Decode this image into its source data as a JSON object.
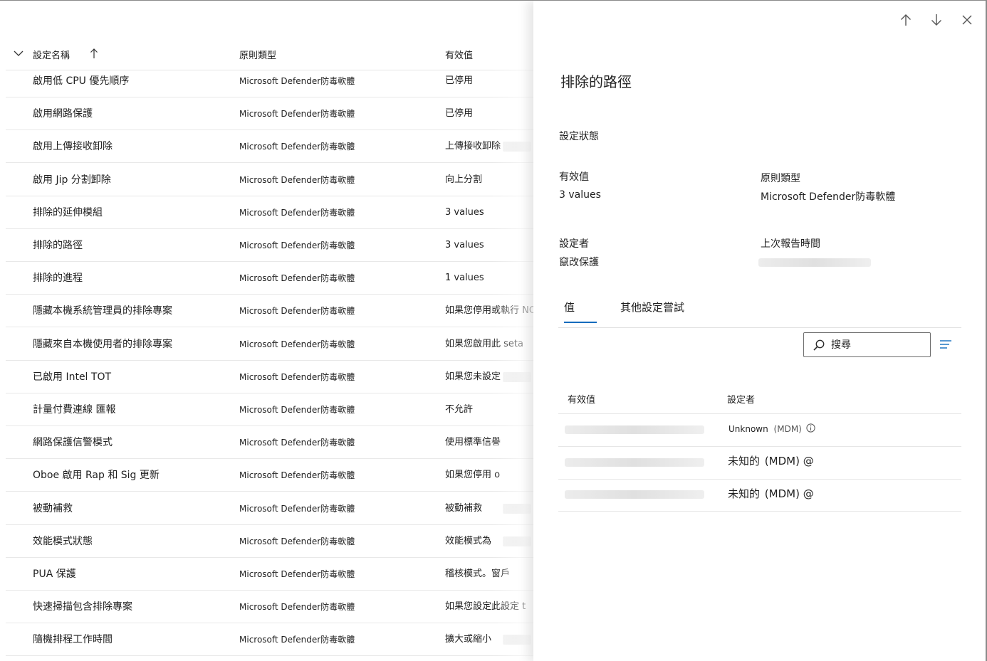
{
  "table": {
    "columns": [
      "設定名稱",
      "原則類型",
      "有效值"
    ],
    "rows": [
      {
        "name": "啟用低 CPU 優先順序",
        "type": "Microsoft Defender防毒軟體",
        "value": "已停用"
      },
      {
        "name": "啟用網路保護",
        "type": "Microsoft Defender防毒軟體",
        "value": "已停用"
      },
      {
        "name": "啟用上傳接收卸除",
        "type": "Microsoft Defender防毒軟體",
        "value": "上傳接收卸除"
      },
      {
        "name": "啟用 Jip 分割卸除",
        "type": "Microsoft Defender防毒軟體",
        "value": "向上分割"
      },
      {
        "name": "排除的延伸模組",
        "type": "Microsoft Defender防毒軟體",
        "value": "3 values"
      },
      {
        "name": "排除的路徑",
        "type": "Microsoft Defender防毒軟體",
        "value": "3 values"
      },
      {
        "name": "排除的進程",
        "type": "Microsoft Defender防毒軟體",
        "value": "1 values"
      },
      {
        "name": "隱藏本機系統管理員的排除專案",
        "type": "Microsoft Defender防毒軟體",
        "value": "如果您停用或執行 NC"
      },
      {
        "name": "隱藏來自本機使用者的排除專案",
        "type": "Microsoft Defender防毒軟體",
        "value": "如果您啟用此 seta"
      },
      {
        "name": "已啟用 Intel TOT",
        "type": "Microsoft Defender防毒軟體",
        "value": "如果您未設定"
      },
      {
        "name": "計量付費連線 匯報",
        "type": "Microsoft Defender防毒軟體",
        "value": "不允許"
      },
      {
        "name": "網路保護信警模式",
        "type": "Microsoft Defender防毒軟體",
        "value": "使用標準信譽"
      },
      {
        "name": "Oboe 啟用 Rap 和 Sig 更新",
        "type": "Microsoft Defender防毒軟體",
        "value": "如果您停用 o"
      },
      {
        "name": "被動補救",
        "type": "Microsoft Defender防毒軟體",
        "value": "被動補救"
      },
      {
        "name": "效能模式狀態",
        "type": "Microsoft Defender防毒軟體",
        "value": "效能模式為"
      },
      {
        "name": "PUA 保護",
        "type": "Microsoft Defender防毒軟體",
        "value": "稽核模式。窗戶"
      },
      {
        "name": "快速掃描包含排除專案",
        "type": "Microsoft Defender防毒軟體",
        "value": "如果您設定此設定 t"
      },
      {
        "name": "隨機排程工作時間",
        "type": "Microsoft Defender防毒軟體",
        "value": "擴大或縮小"
      }
    ]
  },
  "panel": {
    "title": "排除的路徑",
    "status_label": "設定狀態",
    "effective_label": "有效值",
    "effective_value": "3 values",
    "policy_type_label": "原則類型",
    "policy_type_value": "Microsoft Defender防毒軟體",
    "set_by_label": "設定者",
    "set_by_value": "竄改保護",
    "last_report_label": "上次報告時間",
    "tabs": [
      "值",
      "其他設定嘗試"
    ],
    "search_placeholder": "搜尋",
    "values_table": {
      "columns": [
        "有效值",
        "設定者"
      ],
      "rows": [
        {
          "set_by": "Unknown",
          "suffix": "(MDM)"
        },
        {
          "set_by": "未知的",
          "suffix": "(MDM) @"
        },
        {
          "set_by": "未知的",
          "suffix": "(MDM) @"
        }
      ]
    }
  },
  "icons": {
    "sort": "chevron-down-icon",
    "sort_direction": "arrow-up-icon",
    "prev": "arrow-up-icon",
    "next": "arrow-down-icon",
    "close": "close-icon",
    "search": "search-icon",
    "filter": "filter-icon",
    "info": "info-icon"
  },
  "colors": {
    "accent": "#0f6cbd",
    "divider": "#e8e8e8"
  }
}
